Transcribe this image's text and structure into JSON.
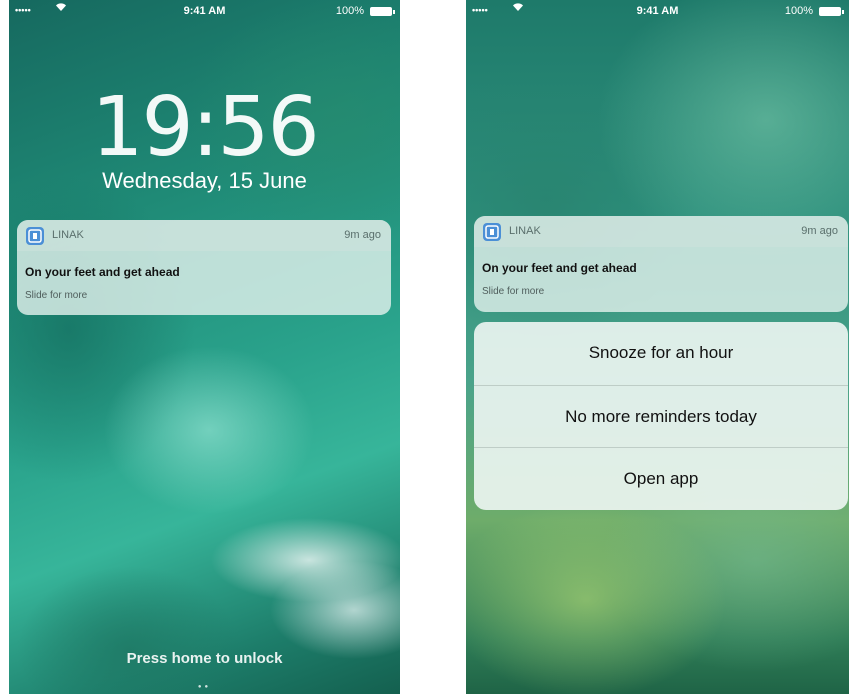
{
  "lock_screen": {
    "status_bar": {
      "signal": "•••••",
      "wifi_icon": "wifi-icon",
      "time": "9:41 AM",
      "battery_percent": "100%",
      "battery_icon": "battery-icon"
    },
    "clock": "19:56",
    "date": "Wednesday, 15 June",
    "notification": {
      "app_icon": "linak-app-icon",
      "app_name": "LINAK",
      "time_ago": "9m ago",
      "title": "On your feet and get ahead",
      "subtitle": "Slide for more"
    },
    "unlock_hint": "Press home to unlock"
  },
  "expanded_screen": {
    "status_bar": {
      "signal": "•••••",
      "wifi_icon": "wifi-icon",
      "time": "9:41 AM",
      "battery_percent": "100%",
      "battery_icon": "battery-icon"
    },
    "notification": {
      "app_icon": "linak-app-icon",
      "app_name": "LINAK",
      "time_ago": "9m ago",
      "title": "On your feet and get ahead",
      "subtitle": "Slide for more"
    },
    "actions": [
      {
        "label": "Snooze for an hour"
      },
      {
        "label": "No more reminders today"
      },
      {
        "label": "Open app"
      }
    ]
  }
}
